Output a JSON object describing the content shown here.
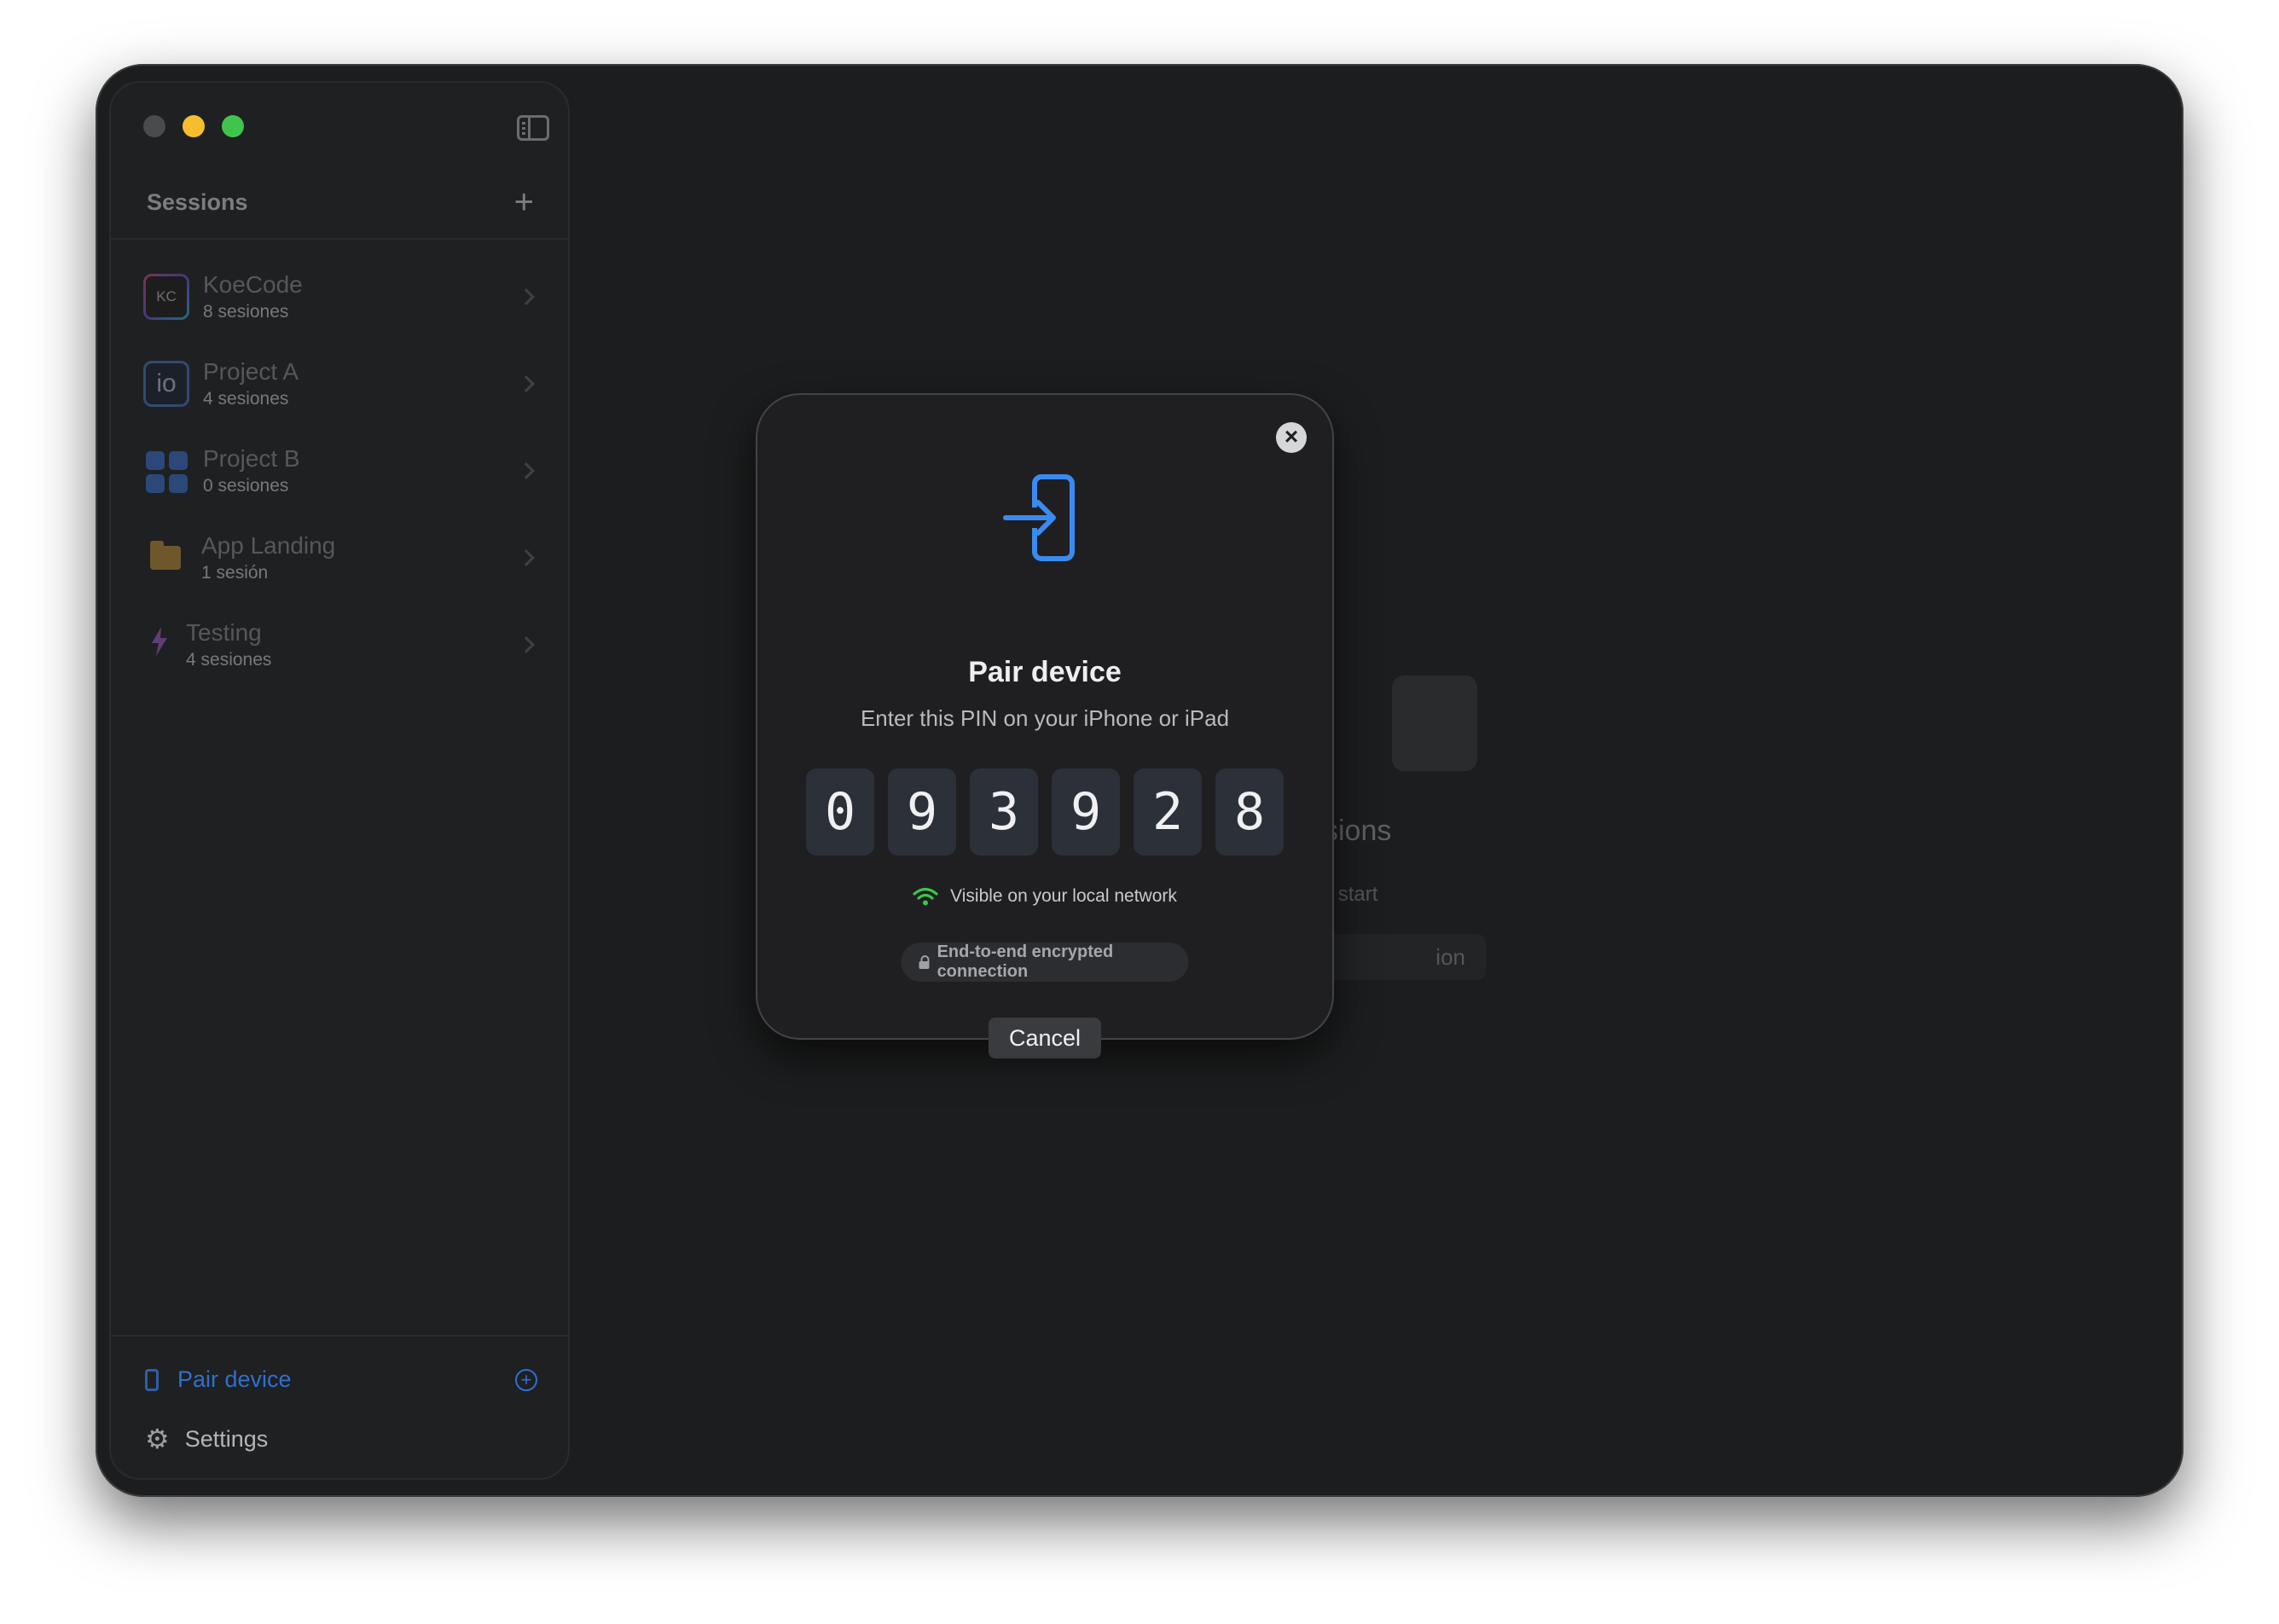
{
  "sidebar": {
    "title": "Sessions",
    "projects": [
      {
        "name": "KoeCode",
        "count": "8 sesiones",
        "icon_text": "KC",
        "icon": "koecode-logo-icon"
      },
      {
        "name": "Project A",
        "count": "4 sesiones",
        "icon_text": "io",
        "icon": "io-logo-icon"
      },
      {
        "name": "Project B",
        "count": "0 sesiones",
        "icon": "grid-apps-icon"
      },
      {
        "name": "App Landing",
        "count": "1 sesión",
        "icon": "folder-icon"
      },
      {
        "name": "Testing",
        "count": "4 sesiones",
        "icon": "bolt-icon"
      }
    ],
    "pair_device_label": "Pair device",
    "settings_label": "Settings"
  },
  "background": {
    "title_partial": "sions",
    "subtitle_partial": "n to start",
    "button_partial": "ion"
  },
  "modal": {
    "title": "Pair device",
    "subtitle": "Enter this PIN on your iPhone or iPad",
    "pin": [
      "0",
      "9",
      "3",
      "9",
      "2",
      "8"
    ],
    "network_status": "Visible on your local network",
    "encryption_label": "End-to-end encrypted connection",
    "cancel_label": "Cancel"
  },
  "colors": {
    "accent": "#3a8bf0",
    "network_ok": "#3fc54c",
    "window_bg": "#1c1d1e"
  }
}
